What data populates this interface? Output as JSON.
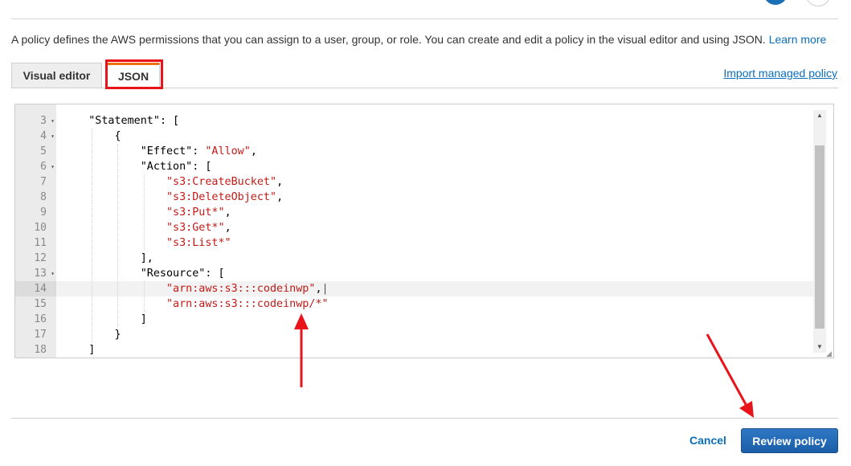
{
  "intro": {
    "text": "A policy defines the AWS permissions that you can assign to a user, group, or role. You can create and edit a policy in the visual editor and using JSON.",
    "learn_more": "Learn more"
  },
  "tabs": [
    {
      "label": "Visual editor",
      "selected": false
    },
    {
      "label": "JSON",
      "selected": true
    }
  ],
  "import_link": "Import managed policy",
  "editor": {
    "active_line": 14,
    "lines": [
      {
        "num": "3",
        "fold": true,
        "tokens": [
          [
            "pun",
            "    "
          ],
          [
            "key",
            "\"Statement\""
          ],
          [
            "pun",
            ": ["
          ]
        ]
      },
      {
        "num": "4",
        "fold": true,
        "tokens": [
          [
            "pun",
            "        {"
          ]
        ]
      },
      {
        "num": "5",
        "fold": false,
        "tokens": [
          [
            "pun",
            "            "
          ],
          [
            "key",
            "\"Effect\""
          ],
          [
            "pun",
            ": "
          ],
          [
            "str",
            "\"Allow\""
          ],
          [
            "pun",
            ","
          ]
        ]
      },
      {
        "num": "6",
        "fold": true,
        "tokens": [
          [
            "pun",
            "            "
          ],
          [
            "key",
            "\"Action\""
          ],
          [
            "pun",
            ": ["
          ]
        ]
      },
      {
        "num": "7",
        "fold": false,
        "tokens": [
          [
            "pun",
            "                "
          ],
          [
            "str",
            "\"s3:CreateBucket\""
          ],
          [
            "pun",
            ","
          ]
        ]
      },
      {
        "num": "8",
        "fold": false,
        "tokens": [
          [
            "pun",
            "                "
          ],
          [
            "str",
            "\"s3:DeleteObject\""
          ],
          [
            "pun",
            ","
          ]
        ]
      },
      {
        "num": "9",
        "fold": false,
        "tokens": [
          [
            "pun",
            "                "
          ],
          [
            "str",
            "\"s3:Put*\""
          ],
          [
            "pun",
            ","
          ]
        ]
      },
      {
        "num": "10",
        "fold": false,
        "tokens": [
          [
            "pun",
            "                "
          ],
          [
            "str",
            "\"s3:Get*\""
          ],
          [
            "pun",
            ","
          ]
        ]
      },
      {
        "num": "11",
        "fold": false,
        "tokens": [
          [
            "pun",
            "                "
          ],
          [
            "str",
            "\"s3:List*\""
          ]
        ]
      },
      {
        "num": "12",
        "fold": false,
        "tokens": [
          [
            "pun",
            "            ],"
          ]
        ]
      },
      {
        "num": "13",
        "fold": true,
        "tokens": [
          [
            "pun",
            "            "
          ],
          [
            "key",
            "\"Resource\""
          ],
          [
            "pun",
            ": ["
          ]
        ]
      },
      {
        "num": "14",
        "fold": false,
        "tokens": [
          [
            "pun",
            "                "
          ],
          [
            "str",
            "\"arn:aws:s3:::codeinwp\""
          ],
          [
            "pun",
            ","
          ]
        ]
      },
      {
        "num": "15",
        "fold": false,
        "tokens": [
          [
            "pun",
            "                "
          ],
          [
            "str",
            "\"arn:aws:s3:::codeinwp/*\""
          ]
        ]
      },
      {
        "num": "16",
        "fold": false,
        "tokens": [
          [
            "pun",
            "            ]"
          ]
        ]
      },
      {
        "num": "17",
        "fold": false,
        "tokens": [
          [
            "pun",
            "        }"
          ]
        ]
      },
      {
        "num": "18",
        "fold": false,
        "tokens": [
          [
            "pun",
            "    ]"
          ]
        ]
      }
    ]
  },
  "footer": {
    "cancel": "Cancel",
    "review": "Review policy"
  },
  "colors": {
    "accent": "#0a6ebd",
    "annotation": "#e8131b",
    "string": "#c41a16"
  },
  "icons": {
    "fold": "fold-arrow-icon",
    "scroll_up": "scroll-up-icon",
    "scroll_down": "scroll-down-icon",
    "resize": "resize-grip-icon"
  }
}
